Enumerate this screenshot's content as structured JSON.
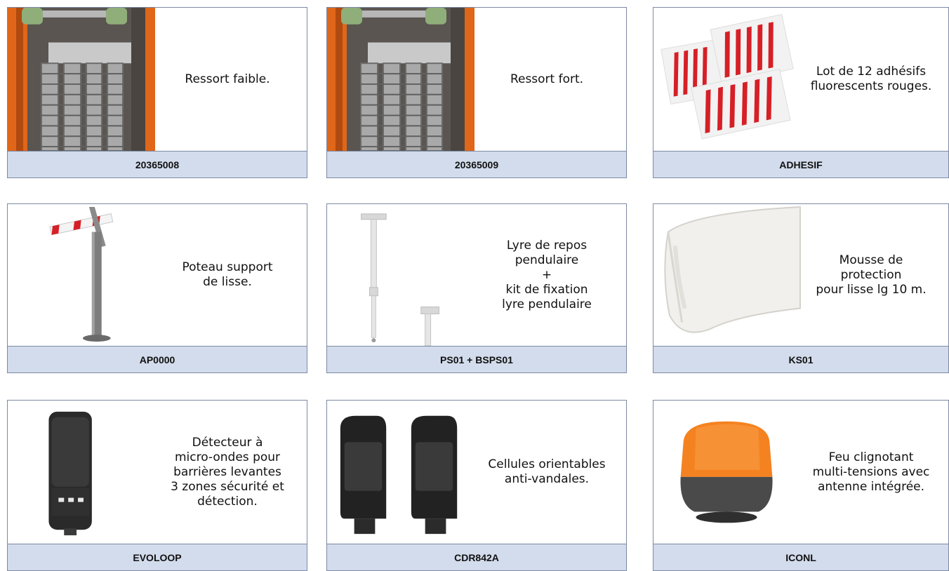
{
  "products": [
    {
      "ref": "20365008",
      "desc": "Ressort faible."
    },
    {
      "ref": "20365009",
      "desc": "Ressort fort."
    },
    {
      "ref": "ADHESIF",
      "desc": "Lot de 12 adhésifs\nfluorescents rouges."
    },
    {
      "ref": "AP0000",
      "desc": "Poteau support\nde lisse."
    },
    {
      "ref": "PS01 + BSPS01",
      "desc": "Lyre de repos\npendulaire\n+\nkit de fixation\nlyre pendulaire"
    },
    {
      "ref": "KS01",
      "desc": "Mousse de\nprotection\npour lisse lg 10 m."
    },
    {
      "ref": "EVOLOOP",
      "desc": "Détecteur à\nmicro-ondes pour\nbarrières levantes\n3 zones sécurité et\ndétection."
    },
    {
      "ref": "CDR842A",
      "desc": "Cellules orientables\nanti-vandales."
    },
    {
      "ref": "ICONL",
      "desc": "Feu clignotant\nmulti-tensions avec\nantenne intégrée."
    }
  ]
}
